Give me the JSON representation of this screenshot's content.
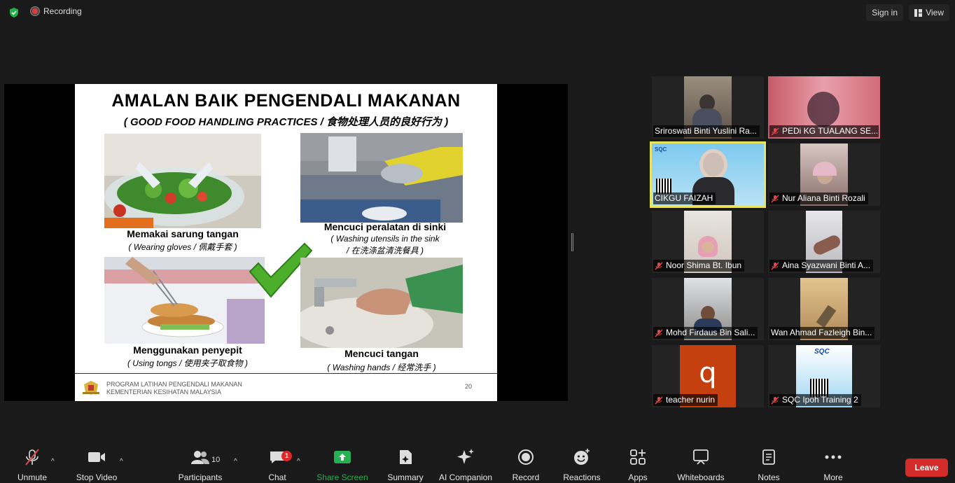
{
  "top_bar": {
    "recording_label": "Recording",
    "sign_in_label": "Sign in",
    "view_label": "View"
  },
  "slide": {
    "title": "AMALAN BAIK PENGENDALI MAKANAN",
    "subtitle": "( GOOD FOOD HANDLING PRACTICES / 食物处理人员的良好行为 )",
    "items": [
      {
        "caption": "Memakai sarung tangan",
        "translation": "( Wearing gloves / 佩戴手套 )"
      },
      {
        "caption": "Mencuci peralatan di sinki",
        "translation_1": "( Washing utensils in the sink",
        "translation_2": "/ 在洗涤盆清洗餐具 )"
      },
      {
        "caption": "Menggunakan penyepit",
        "translation": "( Using tongs / 使用夹子取食物 )"
      },
      {
        "caption": "Mencuci tangan",
        "translation": "( Washing hands / 经常洗手 )"
      }
    ],
    "footer_line_1": "PROGRAM LATIHAN PENGENDALI MAKANAN",
    "footer_line_2": "KEMENTERIAN KESIHATAN MALAYSIA",
    "page_number": "20"
  },
  "participants": [
    {
      "name": "Sriroswati Binti Yuslini Ra...",
      "muted": false
    },
    {
      "name": "PEDi KG TUALANG SE...",
      "muted": true
    },
    {
      "name": "CIKGU FAIZAH",
      "muted": false,
      "active_speaker": true
    },
    {
      "name": "Nur Aliana Binti Rozali",
      "muted": true
    },
    {
      "name": "Noor Shima Bt. Ibun",
      "muted": true
    },
    {
      "name": "Aina Syazwani Binti A...",
      "muted": true
    },
    {
      "name": "Mohd Firdaus Bin Sali...",
      "muted": true
    },
    {
      "name": "Wan Ahmad Fazleigh Bin...",
      "muted": false
    },
    {
      "name": "teacher nurin",
      "muted": true,
      "avatar_letter": "q"
    },
    {
      "name": "SQC Ipoh Training 2",
      "muted": true
    }
  ],
  "toolbar": {
    "unmute": "Unmute",
    "stop_video": "Stop Video",
    "participants": "Participants",
    "participants_count": "10",
    "chat": "Chat",
    "chat_badge": "1",
    "share_screen": "Share Screen",
    "summary": "Summary",
    "ai_companion": "AI Companion",
    "record": "Record",
    "reactions": "Reactions",
    "apps": "Apps",
    "whiteboards": "Whiteboards",
    "notes": "Notes",
    "more": "More",
    "leave": "Leave"
  },
  "colors": {
    "background": "#1a1a1a",
    "active_border": "#e8e360",
    "leave": "#d32a2a",
    "share_green": "#25b052",
    "badge_red": "#e02828"
  }
}
